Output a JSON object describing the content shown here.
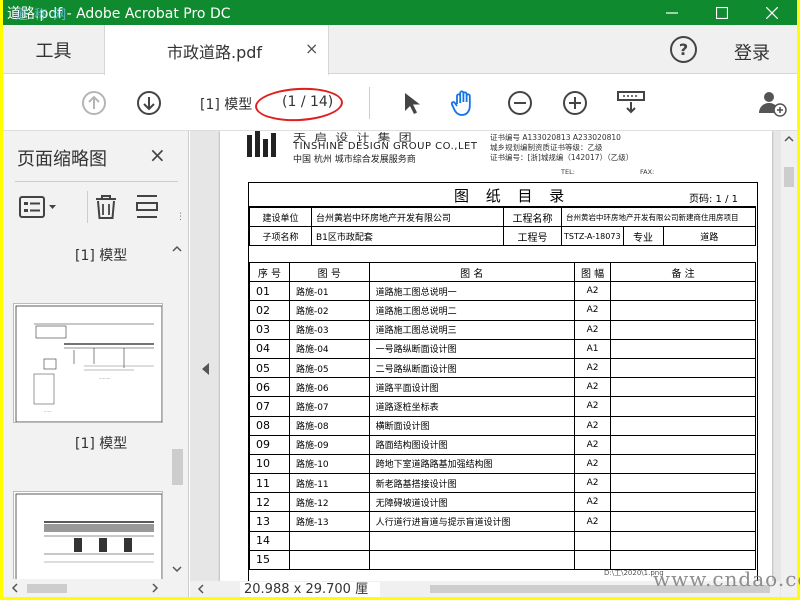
{
  "window": {
    "title": "道路.pdf - Adobe Acrobat Pro DC",
    "watermark": "道 称 网"
  },
  "tabs": {
    "tools_label": "工具",
    "doc_label": "市政道路.pdf",
    "close_symbol": "×",
    "help_symbol": "?",
    "login_label": "登录"
  },
  "toolbar": {
    "page_label": "[1] 模型",
    "page_count": "(1 / 14)"
  },
  "sidebar": {
    "title": "页面缩略图",
    "close_symbol": "×",
    "thumbnails": [
      {
        "label": "[1] 模型"
      },
      {
        "label": "[1] 模型"
      }
    ]
  },
  "statusbar": {
    "page_size": "20.988 x 29.700 厘米"
  },
  "site_watermark": "www.cndao.com",
  "drawing": {
    "company_header": "天 启 设 计 集 团",
    "company_en": "TINSHINE DESIGN GROUP CO.,LET",
    "company_cn": "中国   杭州     城市综合发展服务商",
    "cert_line1": "证书编号 A133020813  A233020810",
    "cert_line2": "城乡规划编制资质证书等级：乙级",
    "cert_line3": "证书编号：[浙]城规编（142017）（乙级）",
    "tel": "TEL:",
    "fax": "FAX:",
    "title": "图 纸 目 录",
    "page_code": "页码: 1 / 1",
    "info": {
      "client_label": "建设单位",
      "client_value": "台州黄岩中环房地产开发有限公司",
      "project_label": "工程名称",
      "project_value": "台州黄岩中环房地产开发有限公司新建商住用房项目",
      "subproject_label": "子项名称",
      "subproject_value": "B1区市政配套",
      "project_no_label": "工程号",
      "project_no_value": "TSTZ-A-18073",
      "discipline_label": "专业",
      "discipline_value": "道路"
    },
    "columns": {
      "no": "序 号",
      "code": "图 号",
      "name": "图 名",
      "size": "图 幅",
      "remark": "备 注"
    },
    "rows": [
      {
        "no": "01",
        "code": "路施-01",
        "name": "道路施工图总说明一",
        "size": "A2",
        "remark": ""
      },
      {
        "no": "02",
        "code": "路施-02",
        "name": "道路施工图总说明二",
        "size": "A2",
        "remark": ""
      },
      {
        "no": "03",
        "code": "路施-03",
        "name": "道路施工图总说明三",
        "size": "A2",
        "remark": ""
      },
      {
        "no": "04",
        "code": "路施-04",
        "name": "一号路纵断面设计图",
        "size": "A1",
        "remark": ""
      },
      {
        "no": "05",
        "code": "路施-05",
        "name": "二号路纵断面设计图",
        "size": "A2",
        "remark": ""
      },
      {
        "no": "06",
        "code": "路施-06",
        "name": "道路平面设计图",
        "size": "A2",
        "remark": ""
      },
      {
        "no": "07",
        "code": "路施-07",
        "name": "道路逐桩坐标表",
        "size": "A2",
        "remark": ""
      },
      {
        "no": "08",
        "code": "路施-08",
        "name": "横断面设计图",
        "size": "A2",
        "remark": ""
      },
      {
        "no": "09",
        "code": "路施-09",
        "name": "路面结构图设计图",
        "size": "A2",
        "remark": ""
      },
      {
        "no": "10",
        "code": "路施-10",
        "name": "跨地下室道路路基加强结构图",
        "size": "A2",
        "remark": ""
      },
      {
        "no": "11",
        "code": "路施-11",
        "name": "新老路基搭接设计图",
        "size": "A2",
        "remark": ""
      },
      {
        "no": "12",
        "code": "路施-12",
        "name": "无障碍坡道设计图",
        "size": "A2",
        "remark": ""
      },
      {
        "no": "13",
        "code": "路施-13",
        "name": "人行道行进盲道与提示盲道设计图",
        "size": "A2",
        "remark": ""
      },
      {
        "no": "14",
        "code": "",
        "name": "",
        "size": "",
        "remark": ""
      },
      {
        "no": "15",
        "code": "",
        "name": "",
        "size": "",
        "remark": ""
      }
    ],
    "stamp_text": "D:\\工\\2020\\1.png"
  }
}
